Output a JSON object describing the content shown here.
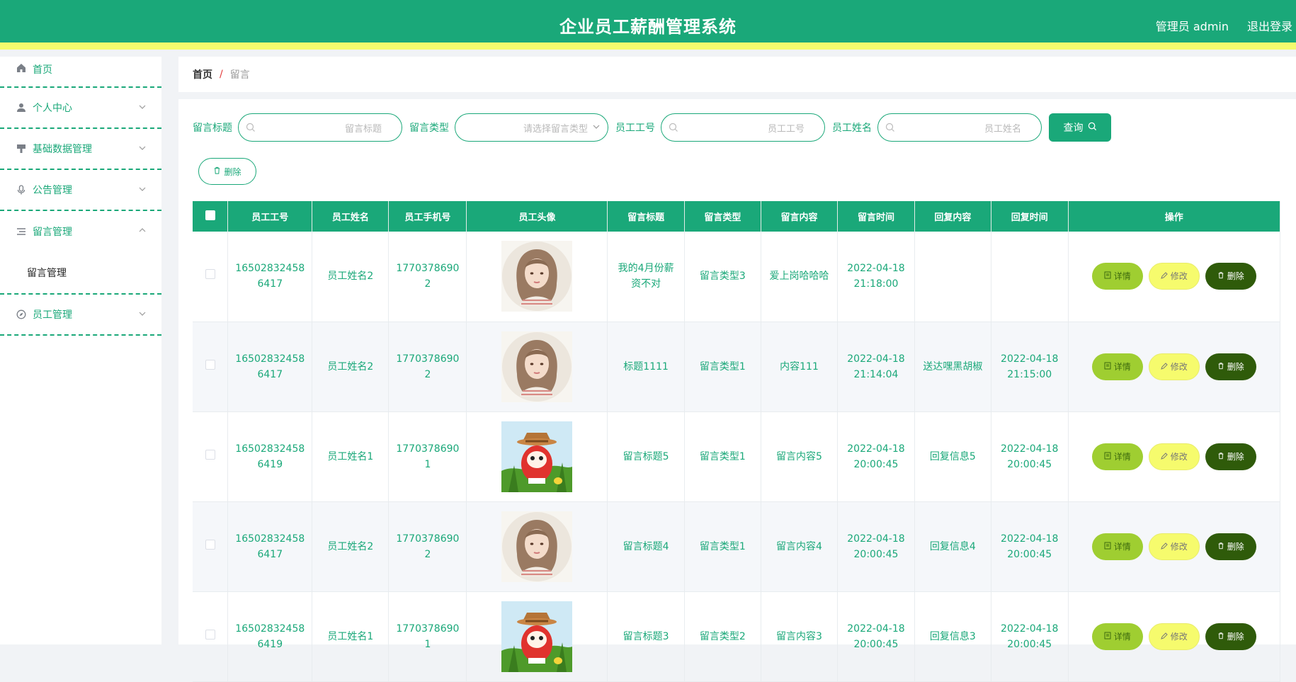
{
  "header": {
    "title": "企业员工薪酬管理系统",
    "user": "管理员 admin",
    "logout": "退出登录"
  },
  "sidebar": {
    "items": [
      {
        "label": "首页",
        "icon": "home-icon"
      },
      {
        "label": "个人中心",
        "icon": "user-icon"
      },
      {
        "label": "基础数据管理",
        "icon": "paint-brush-icon"
      },
      {
        "label": "公告管理",
        "icon": "microphone-icon"
      },
      {
        "label": "留言管理",
        "icon": "list-icon",
        "submenu": "留言管理"
      },
      {
        "label": "员工管理",
        "icon": "compass-icon"
      }
    ]
  },
  "breadcrumb": {
    "home": "首页",
    "separator": "/",
    "current": "留言"
  },
  "search": {
    "title_label": "留言标题",
    "title_placeholder": "留言标题",
    "type_label": "留言类型",
    "type_placeholder": "请选择留言类型",
    "empno_label": "员工工号",
    "empno_placeholder": "员工工号",
    "empname_label": "员工姓名",
    "empname_placeholder": "员工姓名",
    "query_button": "查询"
  },
  "toolbar": {
    "delete_label": "删除"
  },
  "table": {
    "headers": [
      "员工工号",
      "员工姓名",
      "员工手机号",
      "员工头像",
      "留言标题",
      "留言类型",
      "留言内容",
      "留言时间",
      "回复内容",
      "回复时间",
      "操作"
    ],
    "ops": {
      "detail": "详情",
      "edit": "修改",
      "delete": "删除"
    },
    "rows": [
      {
        "emp_no": "16502832458 6417",
        "name": "员工姓名2",
        "phone": "1770378690 2",
        "avatar": "girl-portrait",
        "title": "我的4月份薪资不对",
        "type": "留言类型3",
        "content": "爱上岗哈哈哈",
        "time": "2022-04-18 21:18:00",
        "reply": "",
        "reply_time": ""
      },
      {
        "emp_no": "16502832458 6417",
        "name": "员工姓名2",
        "phone": "1770378690 2",
        "avatar": "girl-portrait",
        "title": "标题1111",
        "type": "留言类型1",
        "content": "内容111",
        "time": "2022-04-18 21:14:04",
        "reply": "送达嘿黑胡椒",
        "reply_time": "2022-04-18 21:15:00"
      },
      {
        "emp_no": "16502832458 6419",
        "name": "员工姓名1",
        "phone": "1770378690 1",
        "avatar": "cartoon-cat",
        "title": "留言标题5",
        "type": "留言类型1",
        "content": "留言内容5",
        "time": "2022-04-18 20:00:45",
        "reply": "回复信息5",
        "reply_time": "2022-04-18 20:00:45"
      },
      {
        "emp_no": "16502832458 6417",
        "name": "员工姓名2",
        "phone": "1770378690 2",
        "avatar": "girl-portrait",
        "title": "留言标题4",
        "type": "留言类型1",
        "content": "留言内容4",
        "time": "2022-04-18 20:00:45",
        "reply": "回复信息4",
        "reply_time": "2022-04-18 20:00:45"
      },
      {
        "emp_no": "16502832458 6419",
        "name": "员工姓名1",
        "phone": "1770378690 1",
        "avatar": "cartoon-cat",
        "title": "留言标题3",
        "type": "留言类型2",
        "content": "留言内容3",
        "time": "2022-04-18 20:00:45",
        "reply": "回复信息3",
        "reply_time": "2022-04-18 20:00:45"
      }
    ]
  },
  "colors": {
    "primary": "#1aa879",
    "accent_strip": "#f4fb6d",
    "detail_btn": "#9fce31",
    "edit_btn": "#f6fb6d",
    "delete_btn": "#2f5b0a"
  }
}
